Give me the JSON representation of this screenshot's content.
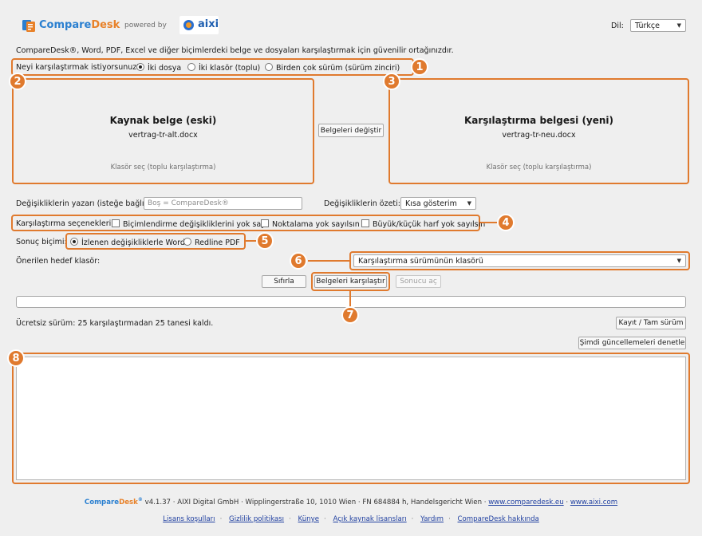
{
  "header": {
    "logo_part1": "Compare",
    "logo_part2": "Desk",
    "powered_by": "powered by",
    "partner_logo": "aixi",
    "language_label": "Dil:",
    "language_value": "Türkçe"
  },
  "intro_text": "CompareDesk®, Word, PDF, Excel ve diğer biçimlerdeki belge ve dosyaları karşılaştırmak için güvenilir ortağınızdır.",
  "mode": {
    "question": "Neyi karşılaştırmak istiyorsunuz?",
    "options": [
      "İki dosya",
      "İki klasör (toplu)",
      "Birden çok sürüm (sürüm zinciri)"
    ],
    "selected": "İki dosya"
  },
  "source": {
    "title": "Kaynak belge (eski)",
    "file": "vertrag-tr-alt.docx",
    "folder_hint": "Klasör seç (toplu karşılaştırma)"
  },
  "target": {
    "title": "Karşılaştırma belgesi (yeni)",
    "file": "vertrag-tr-neu.docx",
    "folder_hint": "Klasör seç (toplu karşılaştırma)"
  },
  "swap_button": "Belgeleri değiştir",
  "author": {
    "label": "Değişikliklerin yazarı (isteğe bağlı):",
    "placeholder": "Boş = CompareDesk®"
  },
  "summary": {
    "label": "Değişikliklerin özeti:",
    "value": "Kısa gösterim"
  },
  "options": {
    "label": "Karşılaştırma seçenekleri:",
    "items": [
      "Biçimlendirme değişikliklerini yok say",
      "Noktalama yok sayılsın",
      "Büyük/küçük harf yok sayılsın"
    ]
  },
  "result_format": {
    "label": "Sonuç biçimi:",
    "options": [
      "İzlenen değişikliklerle Word",
      "Redline PDF"
    ],
    "selected": "İzlenen değişikliklerle Word"
  },
  "target_folder": {
    "label": "Önerilen hedef klasör:",
    "value": "Karşılaştırma sürümünün klasörü"
  },
  "actions": {
    "reset": "Sıfırla",
    "compare": "Belgeleri karşılaştır",
    "open_result": "Sonucu aç"
  },
  "progress": 0,
  "license_status": "Ücretsiz sürüm: 25 karşılaştırmadan 25 tanesi kaldı.",
  "register_button": "Kayıt / Tam sürüm",
  "update_button": "Şimdi güncellemeleri denetle",
  "badges": [
    "1",
    "2",
    "3",
    "4",
    "5",
    "6",
    "7",
    "8"
  ],
  "footer": {
    "brand_part1": "Compare",
    "brand_part2": "Desk",
    "brand_mark": "®",
    "info": "v4.1.37 · AIXI Digital GmbH · Wipplingerstraße 10, 1010 Wien · FN 684884 h, Handelsgericht Wien ·",
    "link1": "www.comparedesk.eu",
    "dot": "·",
    "link2": "www.aixi.com",
    "links": [
      "Lisans koşulları",
      "Gizlilik politikası",
      "Künye",
      "Açık kaynak lisansları",
      "Yardım",
      "CompareDesk hakkında"
    ]
  },
  "colors": {
    "highlight": "#e07a2e",
    "brand_blue": "#2a7fd0",
    "brand_orange": "#e8822a",
    "link": "#1f3fa0"
  }
}
